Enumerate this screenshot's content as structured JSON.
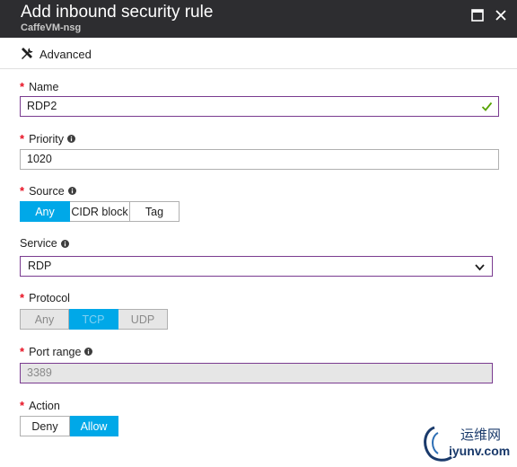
{
  "blade": {
    "title": "Add inbound security rule",
    "subtitle": "CaffeVM-nsg"
  },
  "toolbar": {
    "advanced_label": "Advanced"
  },
  "form": {
    "name": {
      "label": "Name",
      "required": true,
      "value": "RDP2"
    },
    "priority": {
      "label": "Priority",
      "required": true,
      "value": "1020"
    },
    "source": {
      "label": "Source",
      "required": true,
      "options": [
        "Any",
        "CIDR block",
        "Tag"
      ],
      "selected": "Any"
    },
    "service": {
      "label": "Service",
      "required": false,
      "value": "RDP"
    },
    "protocol": {
      "label": "Protocol",
      "required": true,
      "options": [
        "Any",
        "TCP",
        "UDP"
      ],
      "selected": "TCP",
      "disabled": true
    },
    "port_range": {
      "label": "Port range",
      "required": true,
      "value": "3389",
      "disabled": true
    },
    "action": {
      "label": "Action",
      "required": true,
      "options": [
        "Deny",
        "Allow"
      ],
      "selected": "Allow"
    }
  },
  "required_marker": "*",
  "watermark": {
    "cn_text": "运维网",
    "en_text": "iyunv.com"
  },
  "colors": {
    "titlebar_bg": "#2d2d30",
    "selected_segment": "#00a8e8",
    "required_asterisk": "#e81123",
    "focus_border": "#7a3b90",
    "valid_check": "#57a300"
  },
  "icons": {
    "toolbar": "tools-icon",
    "info": "info-icon",
    "valid": "checkmark-icon",
    "dropdown": "chevron-down-icon",
    "maximize": "maximize-icon",
    "close": "close-icon"
  }
}
